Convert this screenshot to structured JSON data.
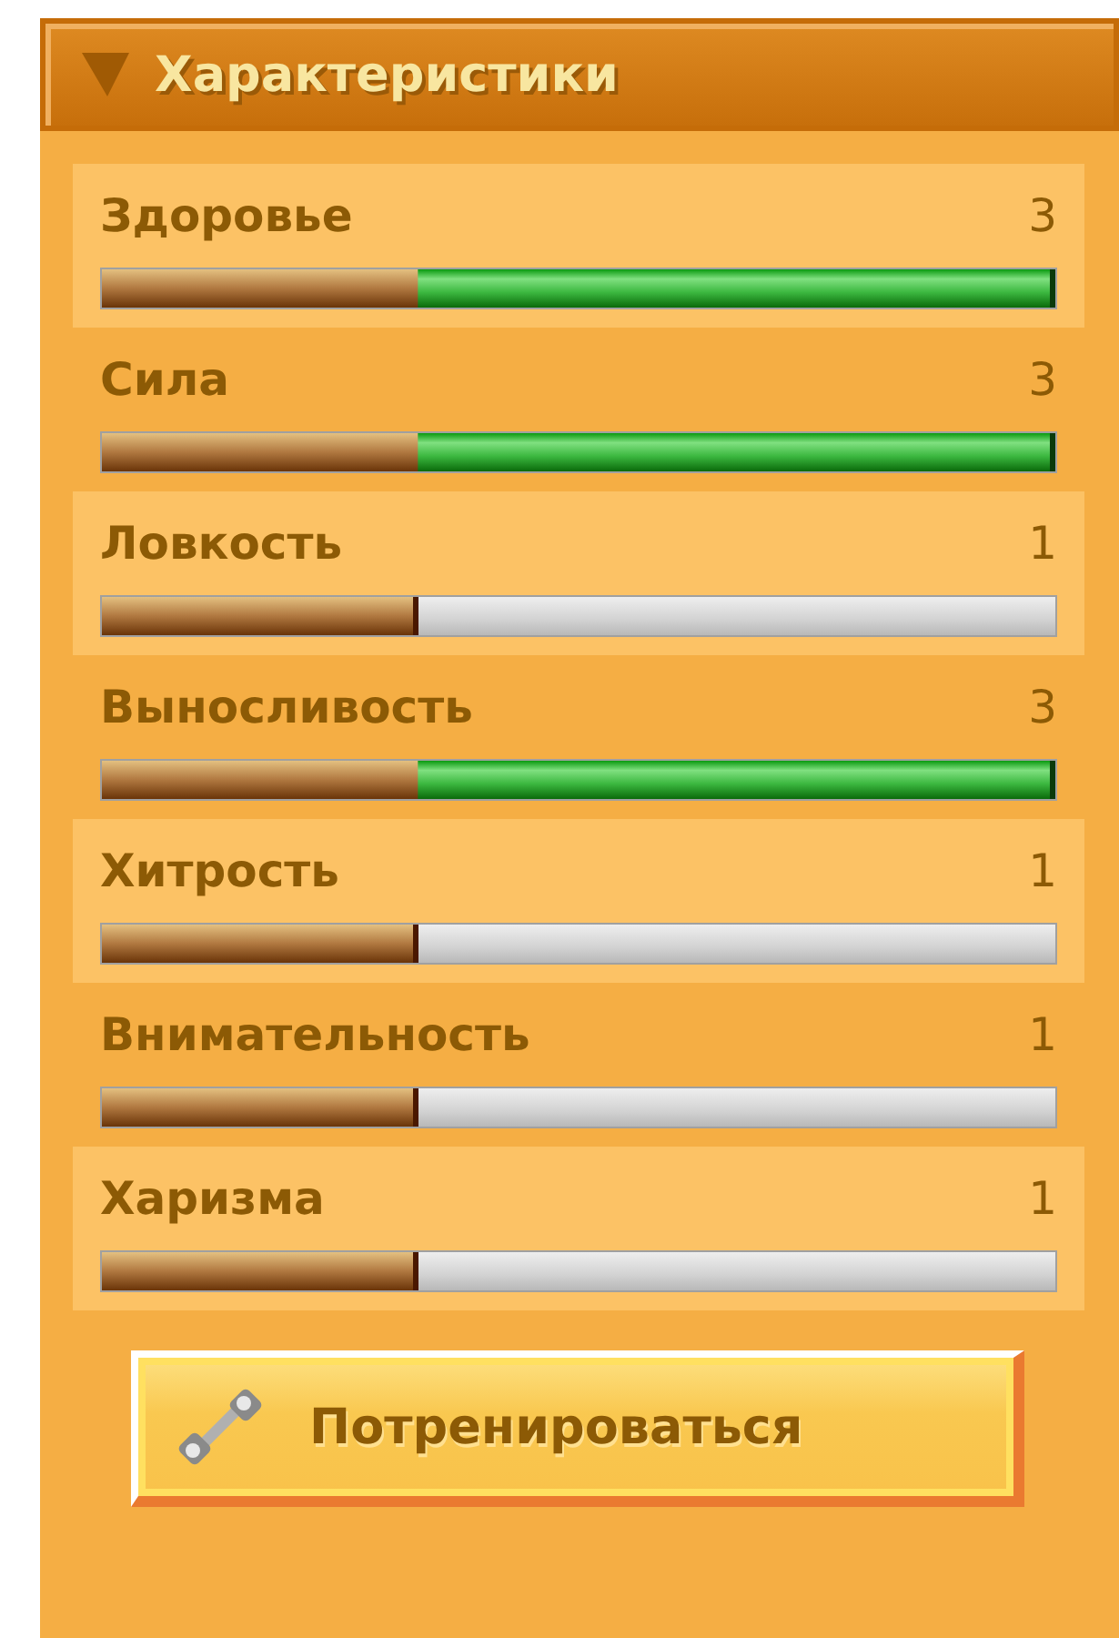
{
  "panel": {
    "title": "Характеристики",
    "expanded": true
  },
  "stats": [
    {
      "name": "Здоровье",
      "value": "3",
      "level": 1
    },
    {
      "name": "Сила",
      "value": "3",
      "level": 1
    },
    {
      "name": "Ловкость",
      "value": "1",
      "level": 0.333
    },
    {
      "name": "Выносливость",
      "value": "3",
      "level": 1
    },
    {
      "name": "Хитрость",
      "value": "1",
      "level": 0.333
    },
    {
      "name": "Внимательность",
      "value": "1",
      "level": 0.333
    },
    {
      "name": "Харизма",
      "value": "1",
      "level": 0.333
    }
  ],
  "button": {
    "label": "Потренироваться"
  }
}
